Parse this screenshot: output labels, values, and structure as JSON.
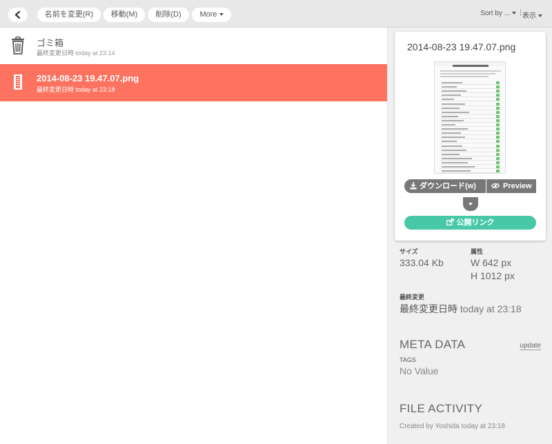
{
  "toolbar": {
    "rename_label": "名前を変更(R)",
    "move_label": "移動(M)",
    "delete_label": "削除(D)",
    "more_label": "More",
    "sort_label": "Sort by ...",
    "separator": "|",
    "display_label": "表示"
  },
  "file_list": {
    "items": [
      {
        "name": "ゴミ箱",
        "modified_label": "最終変更日時",
        "modified_value": "today at 23:14",
        "icon": "trash-icon",
        "selected": false
      },
      {
        "name": "2014-08-23 19.47.07.png",
        "modified_label": "最終変更日時",
        "modified_value": "today at 23:18",
        "icon": "image-file-icon",
        "selected": true
      }
    ]
  },
  "details": {
    "filename": "2014-08-23 19.47.07.png",
    "download_label": "ダウンロード(w)",
    "preview_label": "Preview",
    "share_label": "公開リンク",
    "size_heading": "サイズ",
    "size_value": "333.04 Kb",
    "attributes_heading": "属性",
    "width_value": "W 642 px",
    "height_value": "H 1012 px",
    "modified_heading": "最終変更",
    "modified_label": "最終変更日時",
    "modified_value": "today at 23:18",
    "meta_title": "META DATA",
    "update_label": "update",
    "tags_heading": "TAGS",
    "tags_value": "No Value",
    "activity_title": "FILE ACTIVITY",
    "activity_text": "Created by Yoshida today at 23:18"
  },
  "colors": {
    "selected_row": "#fd7360",
    "share_button": "#47c9a8",
    "action_button": "#777777",
    "toolbar_bg": "#e8e8e8",
    "panel_bg": "#f0f0f0"
  }
}
